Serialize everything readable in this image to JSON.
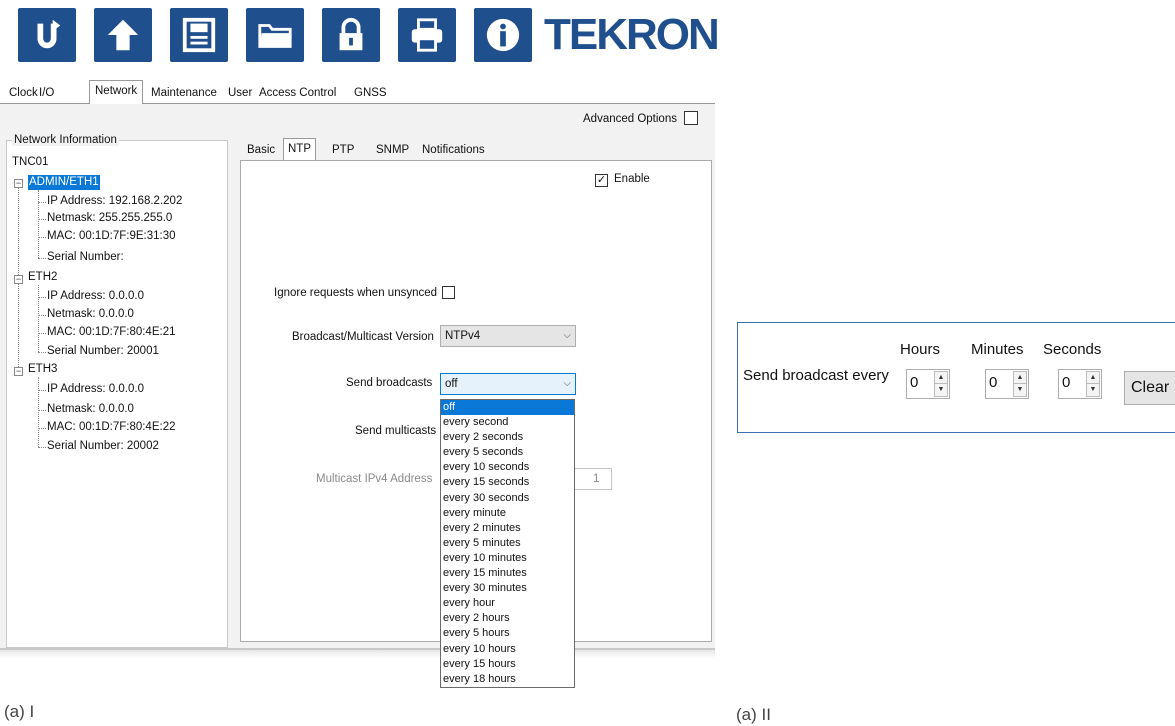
{
  "toolbar": {
    "buttons": [
      "refresh-icon",
      "upload-icon",
      "save-icon",
      "folder-icon",
      "lock-icon",
      "print-icon",
      "info-icon"
    ],
    "logo": "TEKRON",
    "accent": "#1f4f8c"
  },
  "main_tabs": [
    "Clock",
    "I/O",
    "Network",
    "Maintenance",
    "User",
    "Access Control",
    "GNSS"
  ],
  "advanced_options": "Advanced Options",
  "network_info": {
    "legend": "Network Information",
    "root": "TNC01",
    "interfaces": [
      {
        "name": "ADMIN/ETH1",
        "ip": "IP Address: 192.168.2.202",
        "mask": "Netmask: 255.255.255.0",
        "mac": "MAC: 00:1D:7F:9E:31:30",
        "serial": "Serial Number:"
      },
      {
        "name": "ETH2",
        "ip": "IP Address: 0.0.0.0",
        "mask": "Netmask: 0.0.0.0",
        "mac": "MAC: 00:1D:7F:80:4E:21",
        "serial": "Serial Number: 20001"
      },
      {
        "name": "ETH3",
        "ip": "IP Address: 0.0.0.0",
        "mask": "Netmask: 0.0.0.0",
        "mac": "MAC: 00:1D:7F:80:4E:22",
        "serial": "Serial Number: 20002"
      }
    ]
  },
  "sub_tabs": [
    "Basic",
    "NTP",
    "PTP",
    "SNMP",
    "Notifications"
  ],
  "ntp": {
    "enable": "Enable",
    "ignore_label": "Ignore requests when unsynced",
    "version_label": "Broadcast/Multicast Version",
    "version_value": "NTPv4",
    "broadcast_label": "Send broadcasts",
    "broadcast_value": "off",
    "multicast_label": "Send multicasts",
    "multicast_addr_label": "Multicast IPv4 Address",
    "multicast_addr_last": "1",
    "options": [
      "off",
      "every second",
      "every 2 seconds",
      "every 5 seconds",
      "every 10 seconds",
      "every 15 seconds",
      "every 30 seconds",
      "every minute",
      "every 2 minutes",
      "every 5 minutes",
      "every 10 minutes",
      "every 15 minutes",
      "every 30 minutes",
      "every hour",
      "every 2 hours",
      "every 5 hours",
      "every 10 hours",
      "every 15 hours",
      "every 18 hours"
    ]
  },
  "captions": {
    "left": "(a) I",
    "right": "(a) II"
  },
  "fig2": {
    "label": "Send broadcast every",
    "hours_label": "Hours",
    "minutes_label": "Minutes",
    "seconds_label": "Seconds",
    "hours": "0",
    "minutes": "0",
    "seconds": "0",
    "clear": "Clear"
  }
}
